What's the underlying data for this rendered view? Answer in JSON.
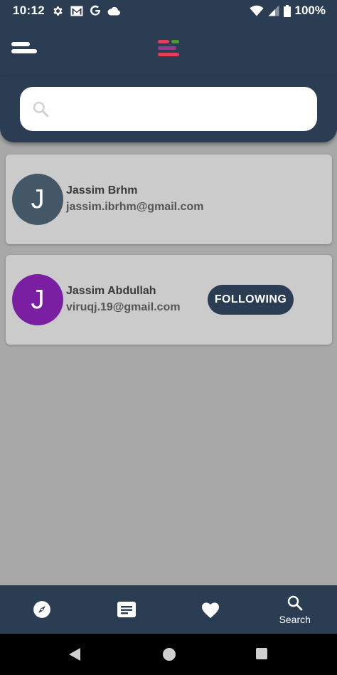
{
  "status_bar": {
    "time": "10:12",
    "battery": "100%",
    "left_icons": [
      "gear-icon",
      "gmail-icon",
      "google-icon",
      "cloud-icon"
    ],
    "right_icons": [
      "wifi-icon",
      "cell-signal-icon",
      "battery-icon"
    ]
  },
  "app_bar": {
    "menu_icon": "menu-icon",
    "logo_icon": "app-logo",
    "logo_colors": [
      "#e0405a",
      "#4a9a3a",
      "#9a3a8a",
      "#e0405a"
    ]
  },
  "search": {
    "placeholder": "",
    "value": "",
    "icon": "search-icon"
  },
  "users": [
    {
      "initial": "J",
      "name": "Jassim Brhm",
      "email": "jassim.ibrhm@gmail.com",
      "avatar_color": "#435766",
      "follow_label": null
    },
    {
      "initial": "J",
      "name": "Jassim Abdullah",
      "email": "viruqj.19@gmail.com",
      "avatar_color": "#7b1fa2",
      "follow_label": "FOLLOWING"
    }
  ],
  "bottom_nav": {
    "items": [
      {
        "icon": "compass-icon",
        "label": ""
      },
      {
        "icon": "article-icon",
        "label": ""
      },
      {
        "icon": "heart-icon",
        "label": ""
      },
      {
        "icon": "search-icon",
        "label": "Search"
      }
    ]
  },
  "colors": {
    "primary": "#2b3d52",
    "background": "#a8a8a8",
    "card": "#cbcbcb"
  }
}
